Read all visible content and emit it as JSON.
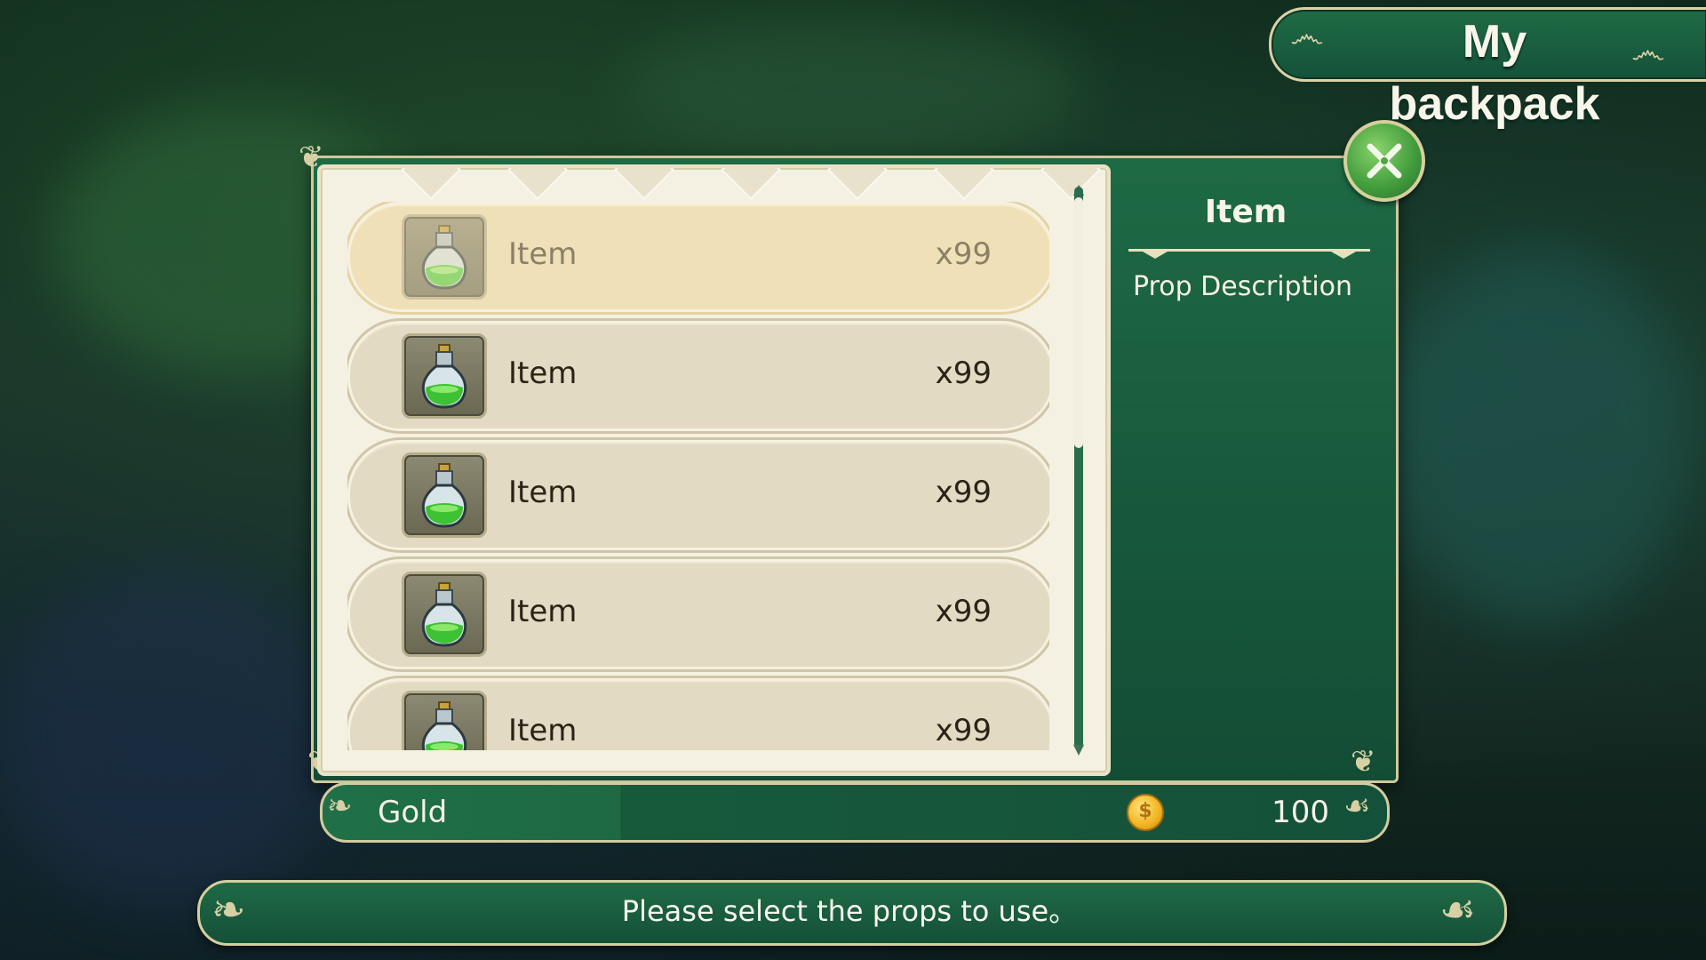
{
  "title": "My backpack",
  "items": [
    {
      "name": "Item",
      "qty": "x99",
      "icon": "green-potion-icon",
      "selected": true
    },
    {
      "name": "Item",
      "qty": "x99",
      "icon": "green-potion-icon",
      "selected": false
    },
    {
      "name": "Item",
      "qty": "x99",
      "icon": "green-potion-icon",
      "selected": false
    },
    {
      "name": "Item",
      "qty": "x99",
      "icon": "green-potion-icon",
      "selected": false
    },
    {
      "name": "Item",
      "qty": "x99",
      "icon": "green-potion-icon",
      "selected": false
    }
  ],
  "detail": {
    "title": "Item",
    "description": "Prop Description"
  },
  "gold": {
    "label": "Gold",
    "value": "100",
    "icon": "gold-coin-icon"
  },
  "message": "Please select the props to use。",
  "colors": {
    "panel_green": "#1e6a45",
    "cream": "#f5f1e2",
    "gold_trim": "#d6ce9f",
    "row_bg": "#e2dac2",
    "selected_row_bg": "#efe0b8"
  }
}
